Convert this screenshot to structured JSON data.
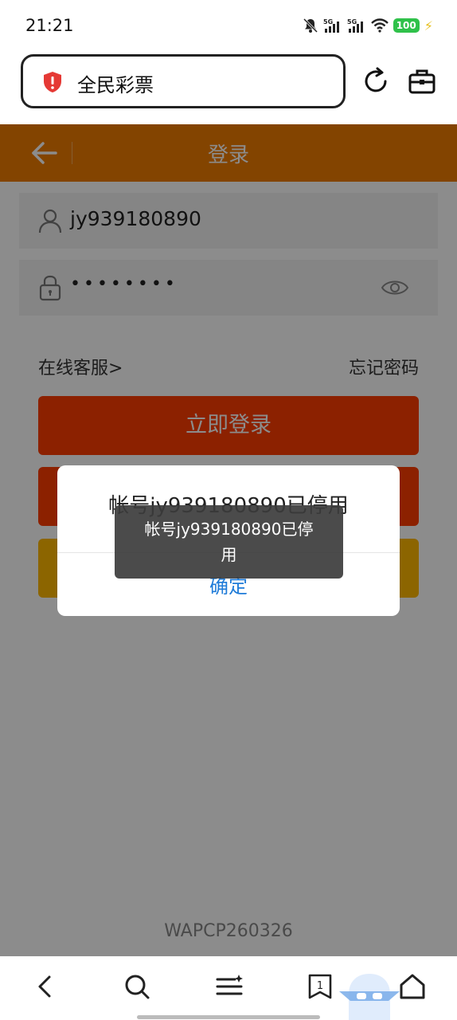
{
  "status_bar": {
    "time": "21:21",
    "network_1": "5G",
    "network_2": "5G",
    "battery": "100"
  },
  "browser": {
    "address_text": "全民彩票"
  },
  "header": {
    "title": "登录"
  },
  "form": {
    "username_value": "jy939180890",
    "password_value": "••••••••",
    "service_link": "在线客服>",
    "forgot_link": "忘记密码",
    "login_button": "立即登录"
  },
  "dialog": {
    "message": "帐号jy939180890已停用",
    "confirm_label": "确定"
  },
  "toast": {
    "message": "帐号jy939180890已停用"
  },
  "footer": {
    "version": "WAPCP260326"
  },
  "bottom_nav": {
    "tab_count": "1"
  },
  "colors": {
    "header": "#ee7d00",
    "primary_button": "#ff3c00",
    "secondary_button": "#ffb800",
    "dialog_action": "#1f7bd8"
  }
}
